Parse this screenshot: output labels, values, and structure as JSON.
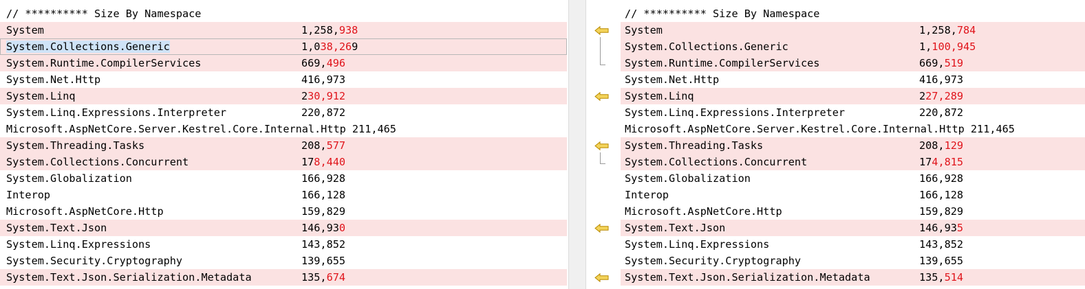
{
  "left": {
    "rows": [
      {
        "name": "// ********** Size By Namespace",
        "same": "",
        "diff": "",
        "changed": false
      },
      {
        "name": "System",
        "same": "1,258,",
        "diff": "938",
        "changed": true
      },
      {
        "name": "System.Collections.Generic",
        "same": "1,0",
        "diff": "38,26",
        "tail": "9",
        "changed": true,
        "selected": true
      },
      {
        "name": "System.Runtime.CompilerServices",
        "same": "669,",
        "diff": "496",
        "changed": true
      },
      {
        "name": "System.Net.Http",
        "same": "416,973",
        "diff": "",
        "changed": false
      },
      {
        "name": "System.Linq",
        "same": "2",
        "diff": "30,912",
        "changed": true
      },
      {
        "name": "System.Linq.Expressions.Interpreter",
        "same": "220,872",
        "diff": "",
        "changed": false
      },
      {
        "name": "Microsoft.AspNetCore.Server.Kestrel.Core.Internal.Http 211,465",
        "same": "",
        "diff": "",
        "changed": false,
        "wide": true
      },
      {
        "name": "System.Threading.Tasks",
        "same": "208,",
        "diff": "577",
        "changed": true
      },
      {
        "name": "System.Collections.Concurrent",
        "same": "17",
        "diff": "8,440",
        "changed": true
      },
      {
        "name": "System.Globalization",
        "same": "166,928",
        "diff": "",
        "changed": false
      },
      {
        "name": "Interop",
        "same": "166,128",
        "diff": "",
        "changed": false
      },
      {
        "name": "Microsoft.AspNetCore.Http",
        "same": "159,829",
        "diff": "",
        "changed": false
      },
      {
        "name": "System.Text.Json",
        "same": "146,93",
        "diff": "0",
        "changed": true
      },
      {
        "name": "System.Linq.Expressions",
        "same": "143,852",
        "diff": "",
        "changed": false
      },
      {
        "name": "System.Security.Cryptography",
        "same": "139,655",
        "diff": "",
        "changed": false
      },
      {
        "name": "System.Text.Json.Serialization.Metadata",
        "same": "135,",
        "diff": "674",
        "changed": true
      }
    ]
  },
  "right": {
    "rows": [
      {
        "name": "// ********** Size By Namespace",
        "same": "",
        "diff": "",
        "changed": false
      },
      {
        "name": "System",
        "same": "1,258,",
        "diff": "784",
        "changed": true
      },
      {
        "name": "System.Collections.Generic",
        "same": "1,",
        "diff": "100,945",
        "changed": true
      },
      {
        "name": "System.Runtime.CompilerServices",
        "same": "669,",
        "diff": "519",
        "changed": true
      },
      {
        "name": "System.Net.Http",
        "same": "416,973",
        "diff": "",
        "changed": false
      },
      {
        "name": "System.Linq",
        "same": "2",
        "diff": "27,289",
        "changed": true
      },
      {
        "name": "System.Linq.Expressions.Interpreter",
        "same": "220,872",
        "diff": "",
        "changed": false
      },
      {
        "name": "Microsoft.AspNetCore.Server.Kestrel.Core.Internal.Http 211,465",
        "same": "",
        "diff": "",
        "changed": false,
        "wide": true
      },
      {
        "name": "System.Threading.Tasks",
        "same": "208,",
        "diff": "129",
        "changed": true
      },
      {
        "name": "System.Collections.Concurrent",
        "same": "17",
        "diff": "4,815",
        "changed": true
      },
      {
        "name": "System.Globalization",
        "same": "166,928",
        "diff": "",
        "changed": false
      },
      {
        "name": "Interop",
        "same": "166,128",
        "diff": "",
        "changed": false
      },
      {
        "name": "Microsoft.AspNetCore.Http",
        "same": "159,829",
        "diff": "",
        "changed": false
      },
      {
        "name": "System.Text.Json",
        "same": "146,93",
        "diff": "5",
        "changed": true
      },
      {
        "name": "System.Linq.Expressions",
        "same": "143,852",
        "diff": "",
        "changed": false
      },
      {
        "name": "System.Security.Cryptography",
        "same": "139,655",
        "diff": "",
        "changed": false
      },
      {
        "name": "System.Text.Json.Serialization.Metadata",
        "same": "135,",
        "diff": "514",
        "changed": true
      }
    ]
  },
  "gutter": {
    "arrow_rows": [
      1,
      5,
      8,
      13,
      16
    ],
    "brackets": [
      {
        "from_row": 2,
        "to_row": 3
      },
      {
        "from_row": 9,
        "to_row": 9
      }
    ],
    "arrow_icon": "left-arrow-icon"
  },
  "colors": {
    "changed_row": "#fbe2e2",
    "diff_text": "#e0141b",
    "arrow_fill": "#f3d35a",
    "arrow_stroke": "#b88a00"
  }
}
